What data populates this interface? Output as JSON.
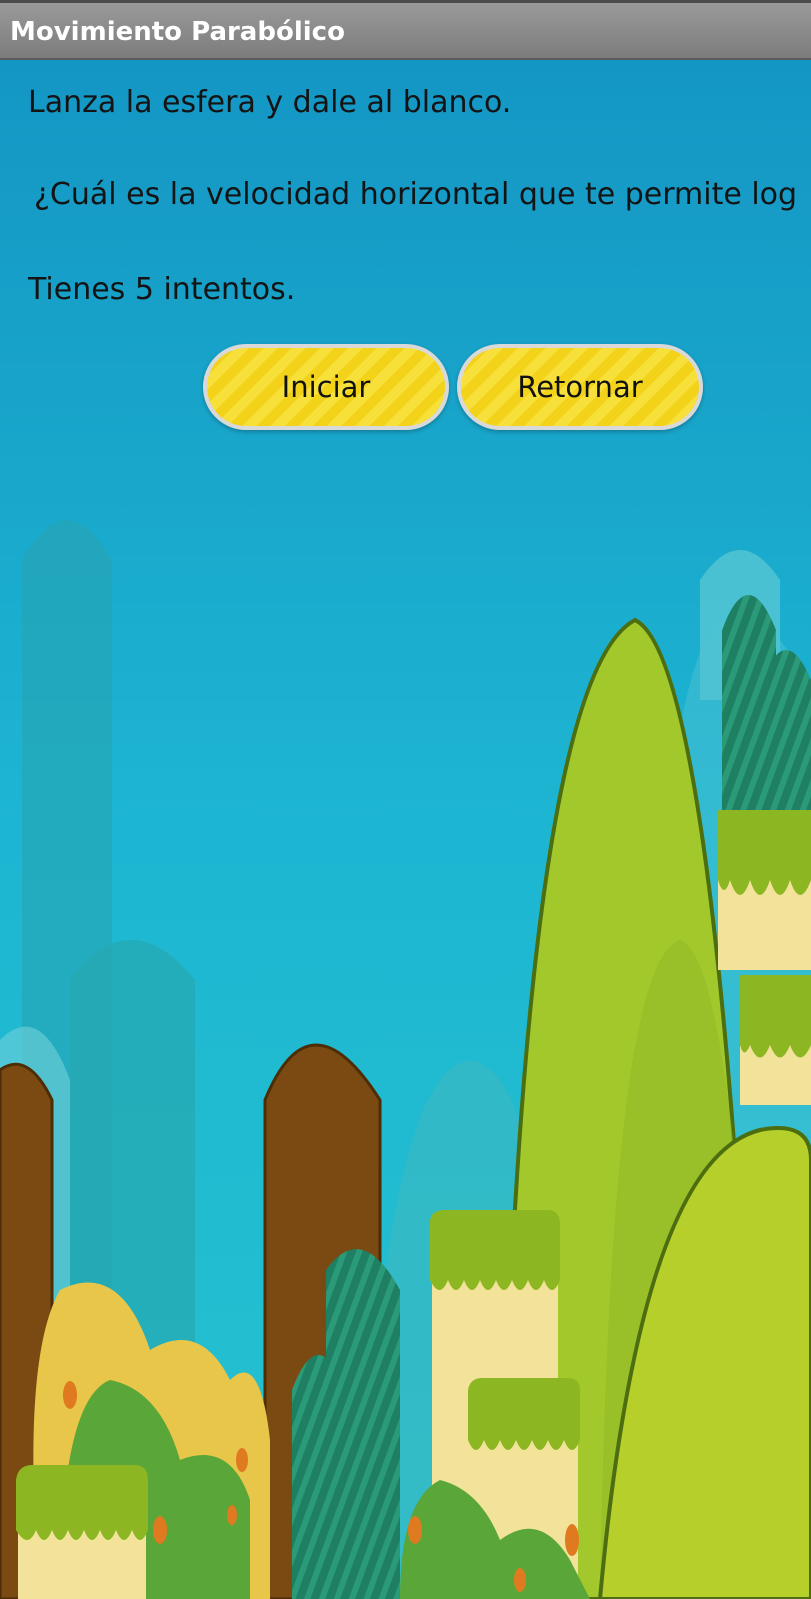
{
  "app": {
    "title": "Movimiento Parabólico"
  },
  "content": {
    "line1": "Lanza la esfera y dale al blanco.",
    "line2": "¿Cuál es la velocidad horizontal que te permite log",
    "line3": "Tienes 5 intentos."
  },
  "buttons": {
    "start_label": "Iniciar",
    "back_label": "Retornar"
  },
  "colors": {
    "sky": "#1aa6cf",
    "button_yellow": "#f7e03a",
    "hill_green": "#9cc22d",
    "trunk_brown": "#7a4a12"
  }
}
